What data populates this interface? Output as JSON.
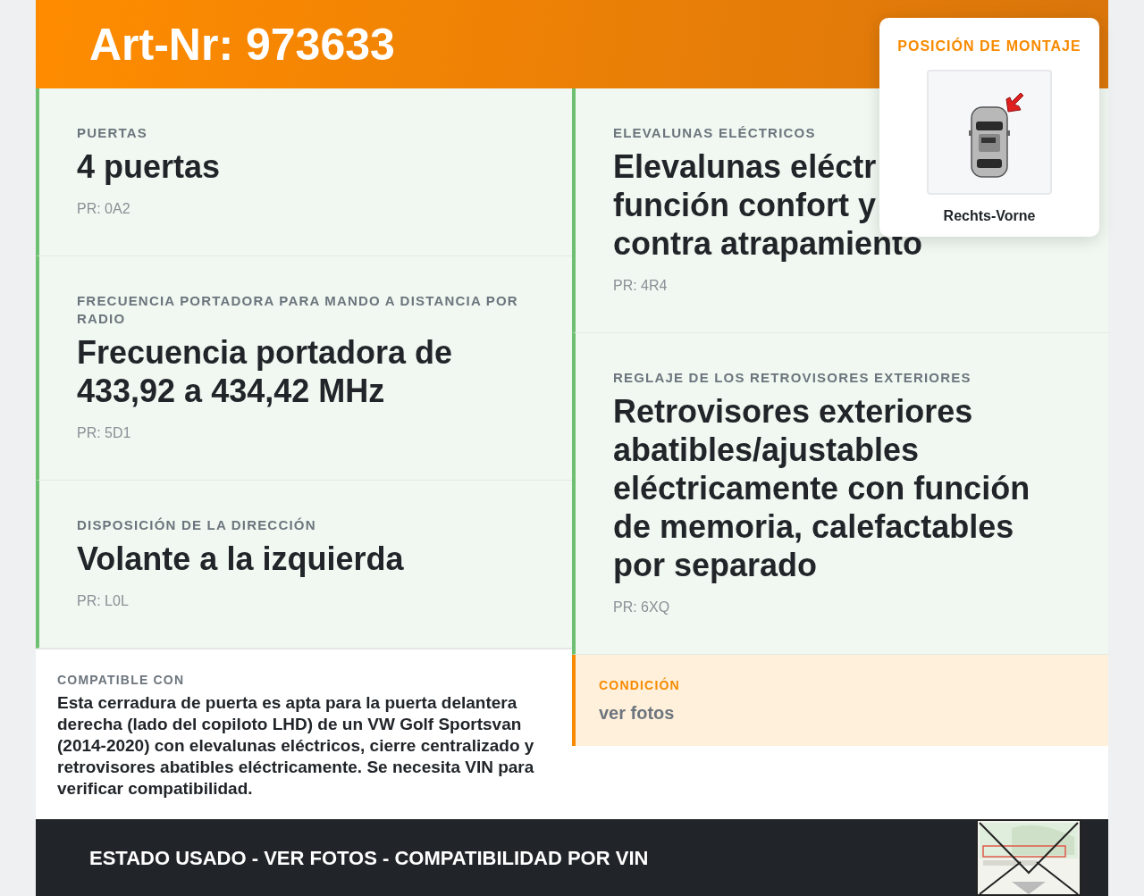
{
  "header": {
    "title": "Art-Nr: 973633"
  },
  "mounting_position": {
    "title": "POSICIÓN DE MONTAJE",
    "label": "Rechts-Vorne"
  },
  "left_features": [
    {
      "label": "PUERTAS",
      "value_lines": [
        "4 puertas"
      ],
      "code": "PR: 0A2"
    },
    {
      "label": "FRECUENCIA PORTADORA PARA MANDO A DISTANCIA POR RADIO",
      "value_lines": [
        "Frecuencia portadora de 433,92 a 434,42 MHz"
      ],
      "code": "PR: 5D1"
    },
    {
      "label": "DISPOSICIÓN DE LA DIRECCIÓN",
      "value_lines": [
        "Volante a la izquierda"
      ],
      "code": "PR: L0L"
    }
  ],
  "right_features": [
    {
      "label": "ELEVALUNAS ELÉCTRICOS",
      "value_lines": [
        "Elevalunas eléctr",
        "función confort y",
        "contra atrapamiento"
      ],
      "code": "PR: 4R4"
    },
    {
      "label": "REGLAJE DE LOS RETROVISORES EXTERIORES",
      "value_lines": [
        "Retrovisores exteriores abatibles/ajustables eléctricamente con función de memoria, calefactables por separado"
      ],
      "code": "PR: 6XQ"
    }
  ],
  "compatibility": {
    "label": "COMPATIBLE CON",
    "text": "Esta cerradura de puerta es apta para la puerta delantera derecha (lado del copiloto LHD) de un VW Golf Sportsvan (2014-2020) con elevalunas eléctricos, cierre centralizado y retrovisores abatibles eléctricamente. Se necesita VIN para verificar compatibilidad."
  },
  "condition": {
    "label": "CONDICIÓN",
    "value": "ver fotos"
  },
  "footer": {
    "text": "ESTADO USADO - VER FOTOS - COMPATIBILIDAD POR VIN"
  }
}
